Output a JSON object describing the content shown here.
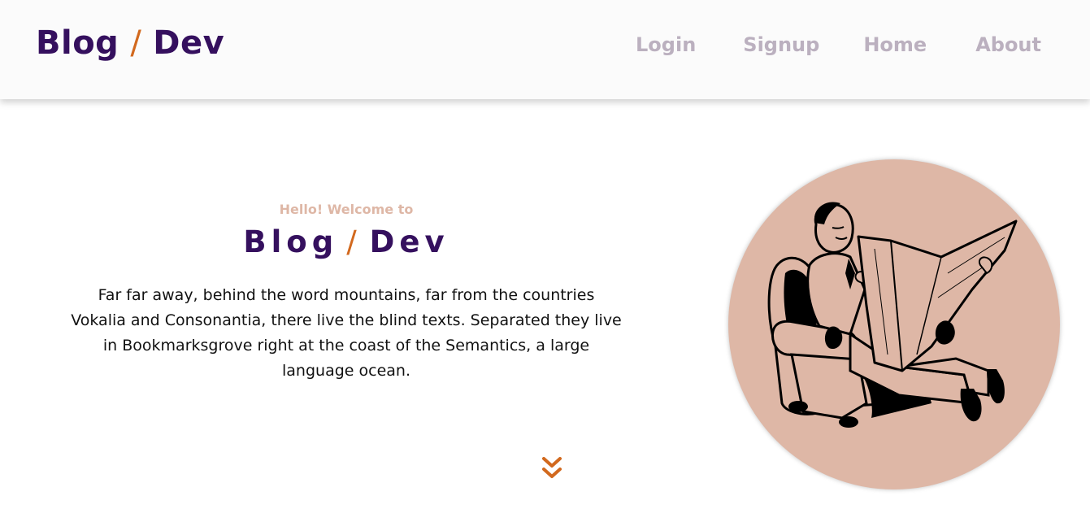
{
  "brand": {
    "name_left": "Blog",
    "separator": "/",
    "name_right": "Dev"
  },
  "nav": {
    "login": "Login",
    "signup": "Signup",
    "home": "Home",
    "about": "About"
  },
  "hero": {
    "welcome": "Hello! Welcome to",
    "title_left": "Blog",
    "title_separator": "/",
    "title_right": "Dev",
    "description": "Far far away, behind the word mountains, far from the countries Vokalia and Consonantia, there live the blind texts. Separated they live in Bookmarksgrove right at the coast of the Semantics, a large language ocean."
  },
  "icons": {
    "scroll": "double-chevron-down-icon",
    "illustration": "man-reading-newspaper-illustration"
  },
  "colors": {
    "brand_purple": "#35105e",
    "accent_orange": "#d2691e",
    "nav_gray": "#bbb0bf",
    "peach": "#deb7a6",
    "navbar_bg": "#fbfbfb"
  }
}
